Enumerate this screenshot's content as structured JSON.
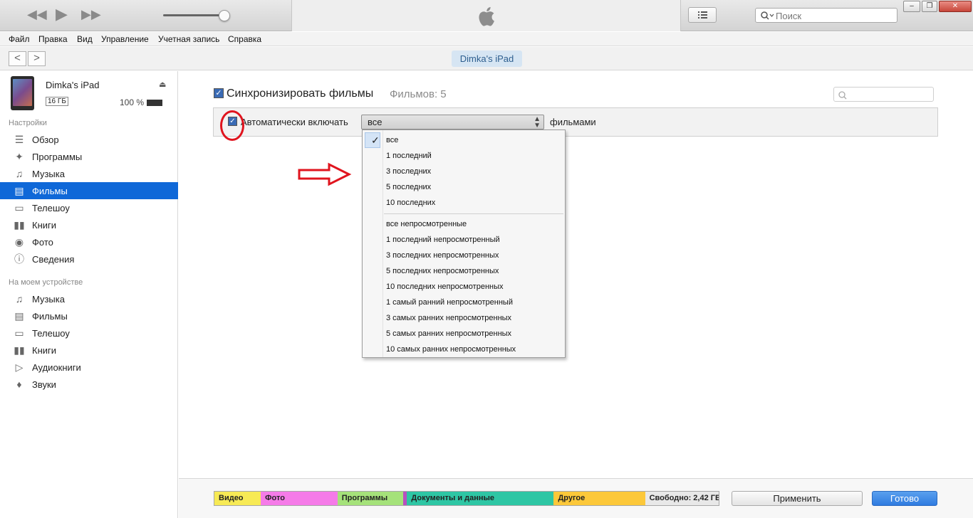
{
  "toolbar": {
    "rewind_icon": "rewind-icon",
    "play_icon": "play-icon",
    "forward_icon": "fast-forward-icon",
    "volume_level": 0.92,
    "search_placeholder": "Поиск"
  },
  "menu": [
    "Файл",
    "Правка",
    "Вид",
    "Управление",
    "Учетная запись",
    "Справка"
  ],
  "nav": {
    "back": "<",
    "forward": ">",
    "device_pill": "Dimka's iPad"
  },
  "device": {
    "name": "Dimka's iPad",
    "capacity": "16 ГБ",
    "battery": "100 %"
  },
  "sidebar": {
    "settings_title": "Настройки",
    "settings": [
      {
        "label": "Обзор",
        "icon": "overview-icon"
      },
      {
        "label": "Программы",
        "icon": "apps-icon"
      },
      {
        "label": "Музыка",
        "icon": "music-icon"
      },
      {
        "label": "Фильмы",
        "icon": "film-icon",
        "active": true
      },
      {
        "label": "Телешоу",
        "icon": "tv-icon"
      },
      {
        "label": "Книги",
        "icon": "book-icon"
      },
      {
        "label": "Фото",
        "icon": "camera-icon"
      },
      {
        "label": "Сведения",
        "icon": "info-icon"
      }
    ],
    "device_title": "На моем устройстве",
    "on_device": [
      {
        "label": "Музыка",
        "icon": "music-icon"
      },
      {
        "label": "Фильмы",
        "icon": "film-icon"
      },
      {
        "label": "Телешоу",
        "icon": "tv-icon"
      },
      {
        "label": "Книги",
        "icon": "book-icon"
      },
      {
        "label": "Аудиокниги",
        "icon": "audiobook-icon"
      },
      {
        "label": "Звуки",
        "icon": "bell-icon"
      }
    ]
  },
  "main": {
    "sync_label": "Синхронизировать фильмы",
    "sync_count": "Фильмов: 5",
    "auto_label": "Автоматически включать",
    "select_value": "все",
    "films_word": "фильмами",
    "dropdown": {
      "group1": [
        "все",
        "1 последний",
        "3 последних",
        "5 последних",
        "10 последних"
      ],
      "group2": [
        "все непросмотренные",
        "1 последний непросмотренный",
        "3 последних непросмотренных",
        "5 последних непросмотренных",
        "10 последних непросмотренных",
        "1 самый ранний непросмотренный",
        "3 самых ранних непросмотренных",
        "5 самых ранних непросмотренных",
        "10 самых ранних непросмотренных"
      ]
    }
  },
  "capacity": {
    "segments": [
      {
        "label": "Видео",
        "color": "#f7ea55",
        "fraction": 0.092
      },
      {
        "label": "Фото",
        "color": "#f57be8",
        "fraction": 0.152
      },
      {
        "label": "Программы",
        "color": "#a5e27a",
        "fraction": 0.131
      },
      {
        "label": "",
        "color": "#b94fc0",
        "fraction": 0.007
      },
      {
        "label": "Документы и данные",
        "color": "#2ec6a4",
        "fraction": 0.291
      },
      {
        "label": "Другое",
        "color": "#fcc83a",
        "fraction": 0.181
      },
      {
        "label": "Свободно: 2,42 ГБ",
        "color": "#e8e8e8",
        "fraction": 0.146
      }
    ]
  },
  "buttons": {
    "apply": "Применить",
    "done": "Готово"
  }
}
